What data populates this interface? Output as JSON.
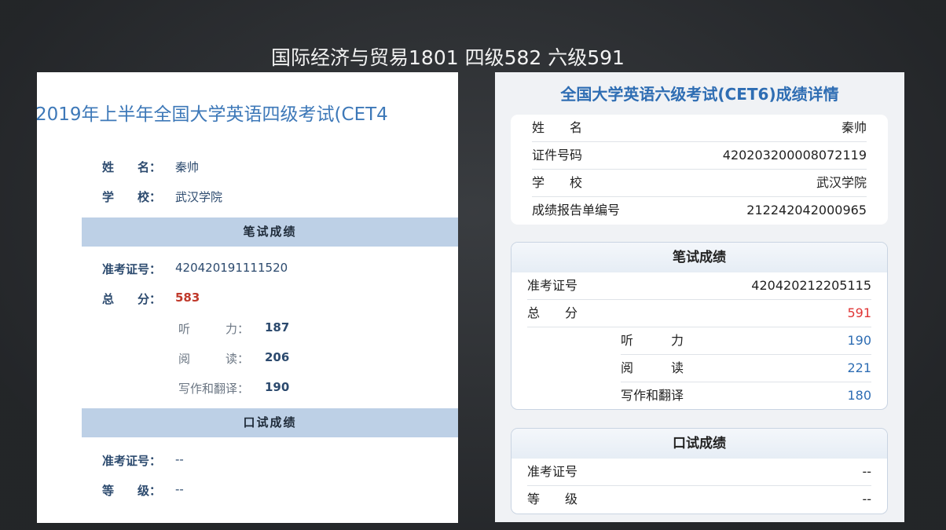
{
  "slide_title": "国际经济与贸易1801  四级582 六级591",
  "cet4": {
    "title": "2019年上半年全国大学英语四级考试(CET4",
    "name_label": "姓　　名：",
    "name_value": "秦帅",
    "school_label": "学　　校：",
    "school_value": "武汉学院",
    "written_header": "笔试成绩",
    "ticket_label": "准考证号：",
    "ticket_value": "420420191111520",
    "total_label": "总　　分：",
    "total_value": "583",
    "listening_label": "听　　　力：",
    "listening_value": "187",
    "reading_label": "阅　　　读：",
    "reading_value": "206",
    "writing_label": "写作和翻译：",
    "writing_value": "190",
    "oral_header": "口试成绩",
    "oral_ticket_label": "准考证号：",
    "oral_ticket_value": "--",
    "grade_label": "等　　级：",
    "grade_value": "--"
  },
  "cet6": {
    "title": "全国大学英语六级考试(CET6)成绩详情",
    "info": [
      {
        "label": "姓　　名",
        "value": "秦帅"
      },
      {
        "label": "证件号码",
        "value": "420203200008072119"
      },
      {
        "label": "学　　校",
        "value": "武汉学院"
      },
      {
        "label": "成绩报告单编号",
        "value": "212242042000965"
      }
    ],
    "written_header": "笔试成绩",
    "ticket_label": "准考证号",
    "ticket_value": "420420212205115",
    "total_label": "总　　分",
    "total_value": "591",
    "listening_label": "听　　　力",
    "listening_value": "190",
    "reading_label": "阅　　　读",
    "reading_value": "221",
    "writing_label": "写作和翻译",
    "writing_value": "180",
    "oral_header": "口试成绩",
    "oral_ticket_label": "准考证号",
    "oral_ticket_value": "--",
    "grade_label": "等　　级",
    "grade_value": "--"
  }
}
